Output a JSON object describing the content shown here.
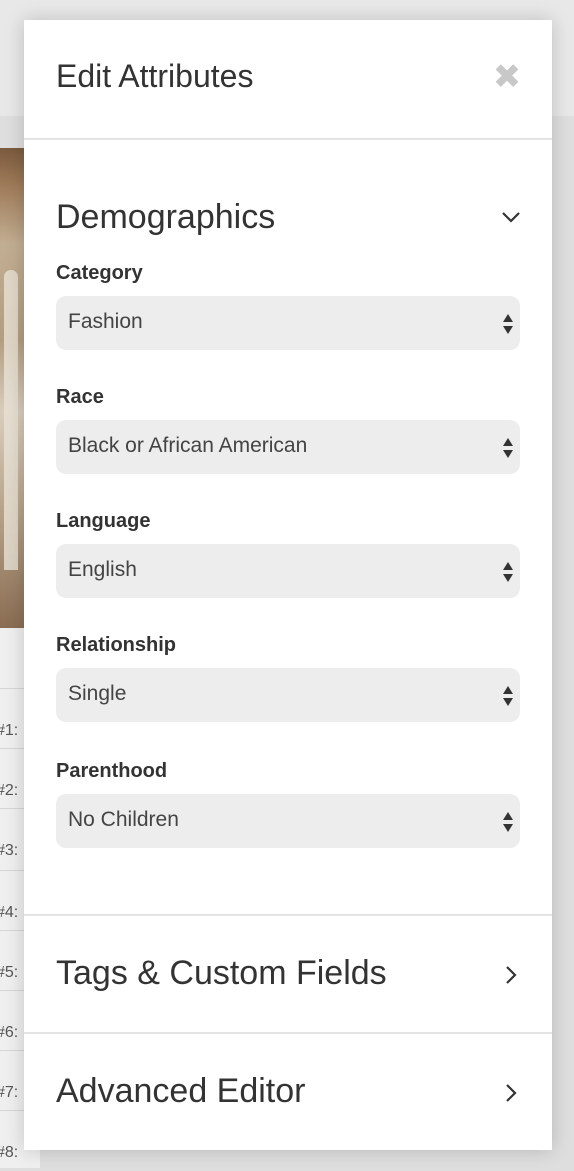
{
  "background": {
    "row_labels": [
      "#1:",
      "#2:",
      "#3:",
      "#4:",
      "#5:",
      "#6:",
      "#7:",
      "#8:"
    ]
  },
  "panel": {
    "title": "Edit Attributes",
    "close_symbol": "✖",
    "sections": {
      "demographics": {
        "title": "Demographics",
        "icon": "chevron-down-icon",
        "fields": [
          {
            "label": "Category",
            "value": "Fashion"
          },
          {
            "label": "Race",
            "value": "Black or African American"
          },
          {
            "label": "Language",
            "value": "English"
          },
          {
            "label": "Relationship",
            "value": "Single"
          },
          {
            "label": "Parenthood",
            "value": "No Children"
          }
        ]
      },
      "tags": {
        "title": "Tags & Custom Fields",
        "icon": "chevron-right-icon"
      },
      "advanced": {
        "title": "Advanced Editor",
        "icon": "chevron-right-icon"
      }
    }
  }
}
